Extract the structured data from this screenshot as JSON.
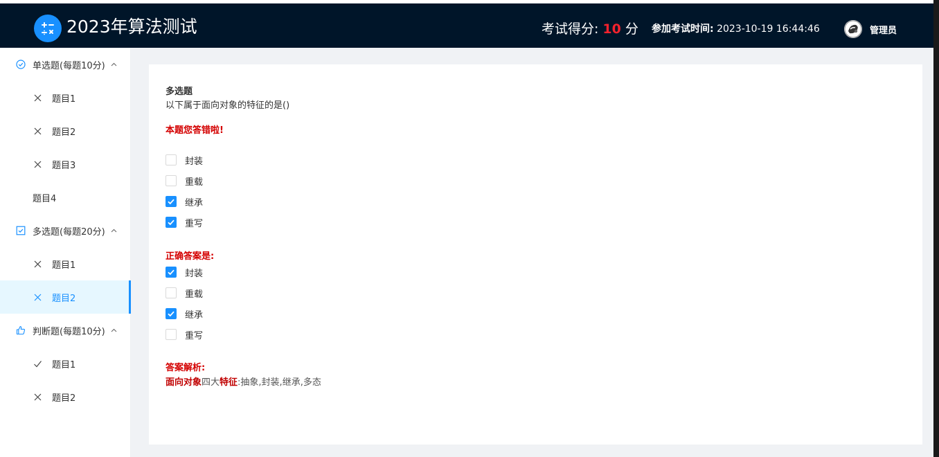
{
  "header": {
    "title": "2023年算法测试",
    "score_label": "考试得分:",
    "score_value": "10",
    "score_unit": "分",
    "time_label": "参加考试时间:",
    "time_value": "2023-10-19 16:44:46",
    "user_name": "管理员",
    "logo_icon": "calculator-icon",
    "accent_color": "#1890ff",
    "header_bg": "#001529"
  },
  "sidebar": {
    "groups": [
      {
        "title": "单选题(每题10分)",
        "icon": "check-circle-icon",
        "items": [
          {
            "label": "题目1",
            "status": "wrong"
          },
          {
            "label": "题目2",
            "status": "wrong"
          },
          {
            "label": "题目3",
            "status": "wrong"
          },
          {
            "label": "题目4",
            "status": "none"
          }
        ]
      },
      {
        "title": "多选题(每题20分)",
        "icon": "check-square-icon",
        "items": [
          {
            "label": "题目1",
            "status": "wrong"
          },
          {
            "label": "题目2",
            "status": "wrong",
            "active": true
          }
        ]
      },
      {
        "title": "判断题(每题10分)",
        "icon": "thumbs-up-icon",
        "items": [
          {
            "label": "题目1",
            "status": "correct"
          },
          {
            "label": "题目2",
            "status": "wrong"
          }
        ]
      }
    ]
  },
  "question": {
    "type": "多选题",
    "stem": "以下属于面向对象的特征的是()",
    "wrong_notice": "本题您答错啦!",
    "user_options": [
      {
        "label": "封装",
        "checked": false
      },
      {
        "label": "重载",
        "checked": false
      },
      {
        "label": "继承",
        "checked": true
      },
      {
        "label": "重写",
        "checked": true
      }
    ],
    "correct_label": "正确答案是:",
    "correct_options": [
      {
        "label": "封装",
        "checked": true
      },
      {
        "label": "重载",
        "checked": false
      },
      {
        "label": "继承",
        "checked": true
      },
      {
        "label": "重写",
        "checked": false
      }
    ],
    "analysis_label": "答案解析:",
    "analysis_part1": "面向对象",
    "analysis_part2": "四大",
    "analysis_part3": "特征",
    "analysis_part4": ":抽象,封装,继承,多态"
  }
}
